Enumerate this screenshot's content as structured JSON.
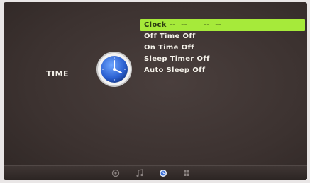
{
  "section": {
    "label": "TIME"
  },
  "menu": {
    "items": [
      {
        "label": "Clock",
        "value": "--  --      --  --",
        "selected": true
      },
      {
        "label": "Off Time",
        "value": "Off",
        "selected": false
      },
      {
        "label": "On Time",
        "value": "Off",
        "selected": false
      },
      {
        "label": "Sleep Timer",
        "value": "Off",
        "selected": false
      },
      {
        "label": "Auto Sleep",
        "value": "Off",
        "selected": false
      }
    ]
  },
  "bottom_bar": {
    "icons": [
      "picture-icon",
      "sound-icon",
      "time-icon",
      "setup-icon"
    ],
    "active": "time-icon"
  },
  "colors": {
    "highlight": "#a6ea3a",
    "background": "#3c3230",
    "text": "#f5f2ea"
  }
}
